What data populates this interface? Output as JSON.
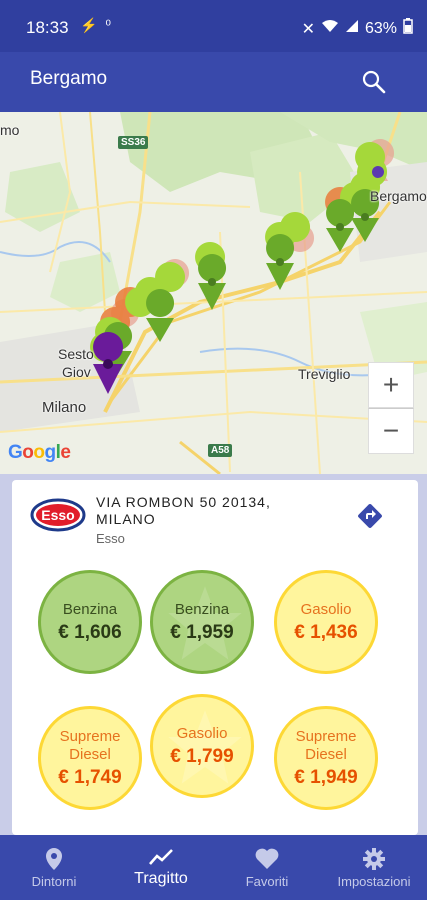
{
  "status_bar": {
    "time": "18:33",
    "battery": "63%"
  },
  "app_bar": {
    "title": "Bergamo"
  },
  "map": {
    "labels": {
      "bergamo": "Bergamo",
      "sesto": "Sesto",
      "giovanni": "Giov",
      "milano": "Milano",
      "treviglio": "Treviglio",
      "mo": "mo"
    },
    "road_shields": {
      "ss36": "SS36",
      "a58": "A58"
    },
    "attribution": "Google",
    "zoom_in": "+",
    "zoom_out": "−"
  },
  "station": {
    "address": "VIA ROMBON 50 20134, MILANO",
    "address_line1": "VIA ROMBON 50 20134,",
    "address_line2": "MILANO",
    "brand": "Esso",
    "logo_text": "Esso"
  },
  "prices": [
    {
      "fuel": "Benzina",
      "value": "€ 1,606",
      "color": "green"
    },
    {
      "fuel": "Benzina",
      "value": "€ 1,959",
      "color": "green",
      "starred": true
    },
    {
      "fuel": "Gasolio",
      "value": "€ 1,436",
      "color": "yellow"
    },
    {
      "fuel": "Supreme Diesel",
      "fuel_line1": "Supreme",
      "fuel_line2": "Diesel",
      "value": "€ 1,749",
      "color": "yellow"
    },
    {
      "fuel": "Gasolio",
      "value": "€ 1,799",
      "color": "yellow",
      "starred": true
    },
    {
      "fuel": "Supreme Diesel",
      "fuel_line1": "Supreme",
      "fuel_line2": "Diesel",
      "value": "€ 1,949",
      "color": "yellow"
    }
  ],
  "bottom_nav": [
    {
      "label": "Dintorni",
      "icon": "location-pin-icon"
    },
    {
      "label": "Tragitto",
      "icon": "route-icon",
      "active": true
    },
    {
      "label": "Favoriti",
      "icon": "heart-icon"
    },
    {
      "label": "Impostazioni",
      "icon": "gear-icon"
    }
  ],
  "colors": {
    "primary": "#3949ab",
    "primary_dark": "#303f9f",
    "price_green": "#aed581",
    "price_yellow": "#fff59d"
  }
}
